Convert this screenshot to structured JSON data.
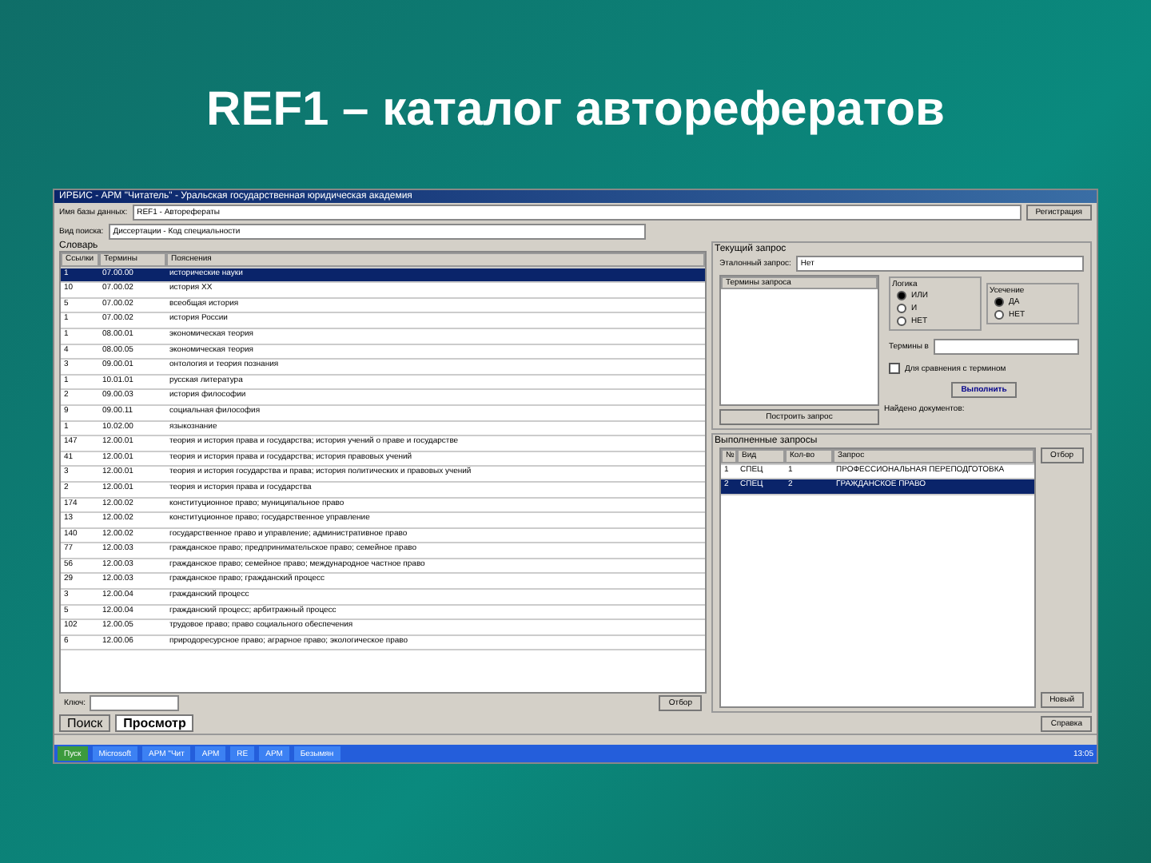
{
  "slide_title": "REF1 – каталог авторефератов",
  "window": {
    "title": "ИРБИС - АРМ \"Читатель\" - Уральская государственная юридическая академия"
  },
  "db": {
    "label": "Имя базы данных:",
    "value": "REF1 - Авторефераты"
  },
  "search_kind": {
    "label": "Вид поиска:",
    "value": "Диссертации - Код специальности"
  },
  "dictionary": {
    "title": "Словарь",
    "columns": [
      "Ссылки",
      "Термины",
      "Пояснения"
    ],
    "rows": [
      {
        "cells": [
          "1",
          "07.00.00",
          "исторические науки"
        ],
        "selected": true
      },
      {
        "cells": [
          "10",
          "07.00.02",
          "история ХХ"
        ],
        "selected": false
      },
      {
        "cells": [
          "5",
          "07.00.02",
          "всеобщая история"
        ],
        "selected": false
      },
      {
        "cells": [
          "1",
          "07.00.02",
          "история России"
        ],
        "selected": false
      },
      {
        "cells": [
          "1",
          "08.00.01",
          "экономическая теория"
        ],
        "selected": false
      },
      {
        "cells": [
          "4",
          "08.00.05",
          "экономическая теория"
        ],
        "selected": false
      },
      {
        "cells": [
          "3",
          "09.00.01",
          "онтология и теория познания"
        ],
        "selected": false
      },
      {
        "cells": [
          "1",
          "10.01.01",
          "русская литература"
        ],
        "selected": false
      },
      {
        "cells": [
          "2",
          "09.00.03",
          "история философии"
        ],
        "selected": false
      },
      {
        "cells": [
          "9",
          "09.00.11",
          "социальная философия"
        ],
        "selected": false
      },
      {
        "cells": [
          "1",
          "10.02.00",
          "языкознание"
        ],
        "selected": false
      },
      {
        "cells": [
          "147",
          "12.00.01",
          "теория и история права и государства; история учений о праве и государстве"
        ],
        "selected": false
      },
      {
        "cells": [
          "41",
          "12.00.01",
          "теория и история права и государства; история правовых учений"
        ],
        "selected": false
      },
      {
        "cells": [
          "3",
          "12.00.01",
          "теория и история государства и права; история политических и правовых учений"
        ],
        "selected": false
      },
      {
        "cells": [
          "2",
          "12.00.01",
          "теория и история права и государства"
        ],
        "selected": false
      },
      {
        "cells": [
          "174",
          "12.00.02",
          "конституционное право; муниципальное право"
        ],
        "selected": false
      },
      {
        "cells": [
          "13",
          "12.00.02",
          "конституционное право; государственное управление"
        ],
        "selected": false
      },
      {
        "cells": [
          "140",
          "12.00.02",
          "государственное право и управление; административное право"
        ],
        "selected": false
      },
      {
        "cells": [
          "77",
          "12.00.03",
          "гражданское право; предпринимательское право; семейное право"
        ],
        "selected": false
      },
      {
        "cells": [
          "56",
          "12.00.03",
          "гражданское право; семейное право; международное частное право"
        ],
        "selected": false
      },
      {
        "cells": [
          "29",
          "12.00.03",
          "гражданское право; гражданский процесс"
        ],
        "selected": false
      },
      {
        "cells": [
          "3",
          "12.00.04",
          "гражданский процесс"
        ],
        "selected": false
      },
      {
        "cells": [
          "5",
          "12.00.04",
          "гражданский процесс; арбитражный процесс"
        ],
        "selected": false
      },
      {
        "cells": [
          "102",
          "12.00.05",
          "трудовое право; право социального обеспечения"
        ],
        "selected": false
      },
      {
        "cells": [
          "6",
          "12.00.06",
          "природоресурсное право; аграрное право; экологическое право"
        ],
        "selected": false
      }
    ],
    "key_label": "Ключ:",
    "select_button": "Отбор"
  },
  "query": {
    "title": "Текущий запрос",
    "template_label": "Эталонный запрос:",
    "template_value": "Нет",
    "terms_header": "Термины запроса",
    "build_button": "Построить запрос",
    "found_label": "Найдено документов:",
    "logic": {
      "title": "Логика",
      "options": [
        {
          "label": "ИЛИ",
          "selected": true
        },
        {
          "label": "И",
          "selected": false
        },
        {
          "label": "НЕТ",
          "selected": false
        }
      ]
    },
    "truncation": {
      "title": "Усечение",
      "options": [
        {
          "label": "ДА",
          "selected": true
        },
        {
          "label": "НЕТ",
          "selected": false
        }
      ]
    },
    "term_in_label": "Термины в",
    "compare": {
      "label": "Для сравнения с термином",
      "checked": false
    },
    "run_button": "Выполнить"
  },
  "done": {
    "title": "Выполненные запросы",
    "columns": [
      "№",
      "Вид",
      "Кол-во",
      "Запрос"
    ],
    "rows": [
      {
        "cells": [
          "1",
          "СПЕЦ",
          "1",
          "ПРОФЕССИОНАЛЬНАЯ ПЕРЕПОДГОТОВКА"
        ],
        "selected": false
      },
      {
        "cells": [
          "2",
          "СПЕЦ",
          "2",
          "ГРАЖДАНСКОЕ ПРАВО"
        ],
        "selected": true
      }
    ],
    "select_button": "Отбор",
    "new_button": "Новый"
  },
  "logo_text": "Регистрация",
  "tabs": [
    {
      "label": "Поиск",
      "selected": false
    },
    {
      "label": "Просмотр",
      "selected": true
    }
  ],
  "help_button": "Справка",
  "taskbar": {
    "start": "Пуск",
    "items": [
      "Microsoft",
      "АРМ \"Чит",
      "АРМ",
      "RE",
      "АРМ",
      "Безымян"
    ],
    "clock": "13:05"
  }
}
